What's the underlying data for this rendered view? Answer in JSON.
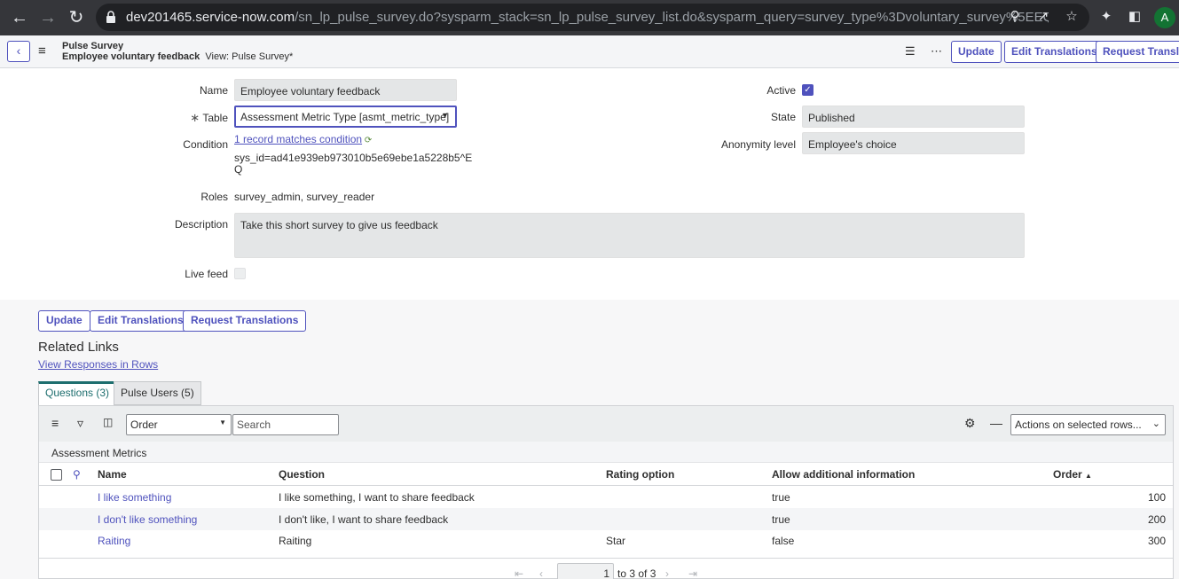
{
  "browser": {
    "url_domain": "dev201465.service-now.com",
    "url_path": "/sn_lp_pulse_survey.do?sysparm_stack=sn_lp_pulse_survey_list.do&sysparm_query=survey_type%3Dvoluntary_survey%5EEQ&sys...",
    "avatar_letter": "A"
  },
  "header": {
    "record_type": "Pulse Survey",
    "record_name": "Employee voluntary feedback",
    "view_label": "View: Pulse Survey*",
    "buttons": {
      "update": "Update",
      "edit_translations": "Edit Translations",
      "request_translations": "Request Translat"
    }
  },
  "form": {
    "name_label": "Name",
    "name_value": "Employee voluntary feedback",
    "table_label": "Table",
    "table_required_mark": "∗",
    "table_value": "Assessment Metric Type [asmt_metric_type]",
    "condition_label": "Condition",
    "condition_link": "1 record matches condition",
    "condition_query_line1": "sys_id=ad41e939eb973010b5e69ebe1a5228b5^E",
    "condition_query_line2": "Q",
    "roles_label": "Roles",
    "roles_value": "survey_admin, survey_reader",
    "description_label": "Description",
    "description_value": "Take this short survey to give us feedback",
    "livefeed_label": "Live feed",
    "active_label": "Active",
    "active_checked": true,
    "state_label": "State",
    "state_value": "Published",
    "anonymity_label": "Anonymity level",
    "anonymity_value": "Employee's choice"
  },
  "actions": {
    "update": "Update",
    "edit_translations": "Edit Translations",
    "request_translations": "Request Translations"
  },
  "related_links": {
    "title": "Related Links",
    "view_responses": "View Responses in Rows"
  },
  "tabs": [
    {
      "label": "Questions (3)",
      "active": true
    },
    {
      "label": "Pulse Users (5)",
      "active": false
    }
  ],
  "list": {
    "filter_field": "Order",
    "search_placeholder": "Search",
    "actions_select": "Actions on selected rows...",
    "title": "Assessment Metrics",
    "columns": [
      "Name",
      "Question",
      "Rating option",
      "Allow additional information",
      "Order"
    ],
    "sort_indicator": "▲",
    "rows": [
      {
        "name": "I like something",
        "question": "I like something, I want to share feedback",
        "rating": "",
        "allow": "true",
        "order": "100"
      },
      {
        "name": "I don't like something",
        "question": "I don't like, I want to share feedback",
        "rating": "",
        "allow": "true",
        "order": "200"
      },
      {
        "name": "Raiting",
        "question": "Raiting",
        "rating": "Star",
        "allow": "false",
        "order": "300"
      }
    ],
    "pager_page": "1",
    "pager_text": "to 3 of 3"
  },
  "colors": {
    "accent": "#4f52bd",
    "tab_active": "#1d6e6e",
    "chrome": "#35363a"
  }
}
